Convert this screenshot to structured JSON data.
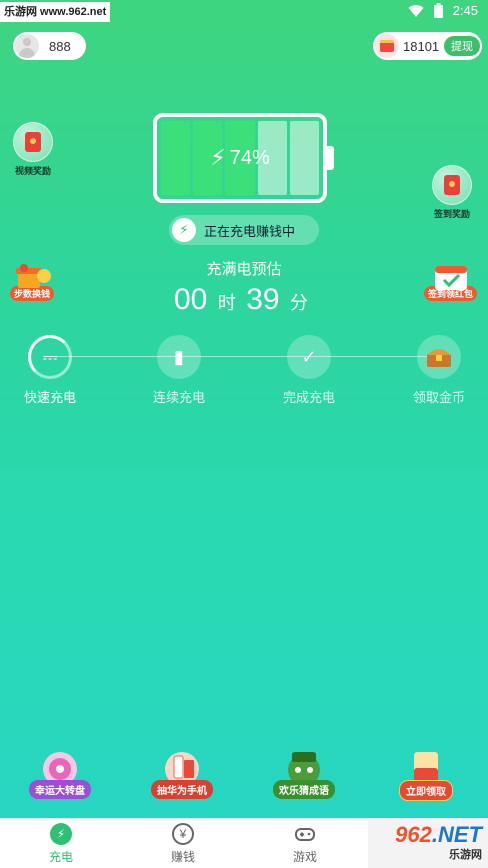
{
  "status": {
    "watermark": "乐游网 www.962.net",
    "time": "2:45"
  },
  "user": {
    "points": "888"
  },
  "coins": {
    "amount": "18101",
    "withdraw_label": "提现"
  },
  "side_rewards": {
    "video_reward": "视频奖励",
    "signin_reward": "签到奖励",
    "steps_to_cash": "步数换钱",
    "signin_redpacket": "签到领红包"
  },
  "battery": {
    "percent_label": "74%",
    "level": 0.74,
    "cells_total": 5,
    "cells_on": 3,
    "colors": {
      "cell_on": "#3ce07a",
      "cell_off": "rgba(255,255,255,0.5)"
    }
  },
  "charging_status": "正在充电赚钱中",
  "full_estimate": {
    "label": "充满电预估",
    "hours": "00",
    "hour_unit": "时",
    "minutes": "39",
    "minute_unit": "分"
  },
  "steps": [
    {
      "label": "快速充电",
      "icon": "plug-icon",
      "active": true
    },
    {
      "label": "连续充电",
      "icon": "battery-icon",
      "active": false
    },
    {
      "label": "完成充电",
      "icon": "check-icon",
      "active": false
    },
    {
      "label": "领取金币",
      "icon": "treasure-chest-icon",
      "active": false
    }
  ],
  "games": [
    {
      "label": "幸运大转盘",
      "icon": "lucky-wheel-icon"
    },
    {
      "label": "抽华为手机",
      "icon": "phone-prize-icon"
    },
    {
      "label": "欢乐猜成语",
      "icon": "idiom-game-icon"
    },
    {
      "label": "立即领取",
      "icon": "countdown-redpacket-icon"
    }
  ],
  "tabs": [
    {
      "label": "充电",
      "icon": "bolt-icon",
      "active": true
    },
    {
      "label": "赚钱",
      "icon": "yuan-icon",
      "active": false
    },
    {
      "label": "游戏",
      "icon": "gamepad-icon",
      "active": false
    }
  ],
  "bottom_watermark": {
    "brand": "962",
    "suffix": ".NET",
    "sub": "乐游网"
  },
  "colors": {
    "accent": "#2fc073",
    "withdraw": "#3cbf6b"
  }
}
